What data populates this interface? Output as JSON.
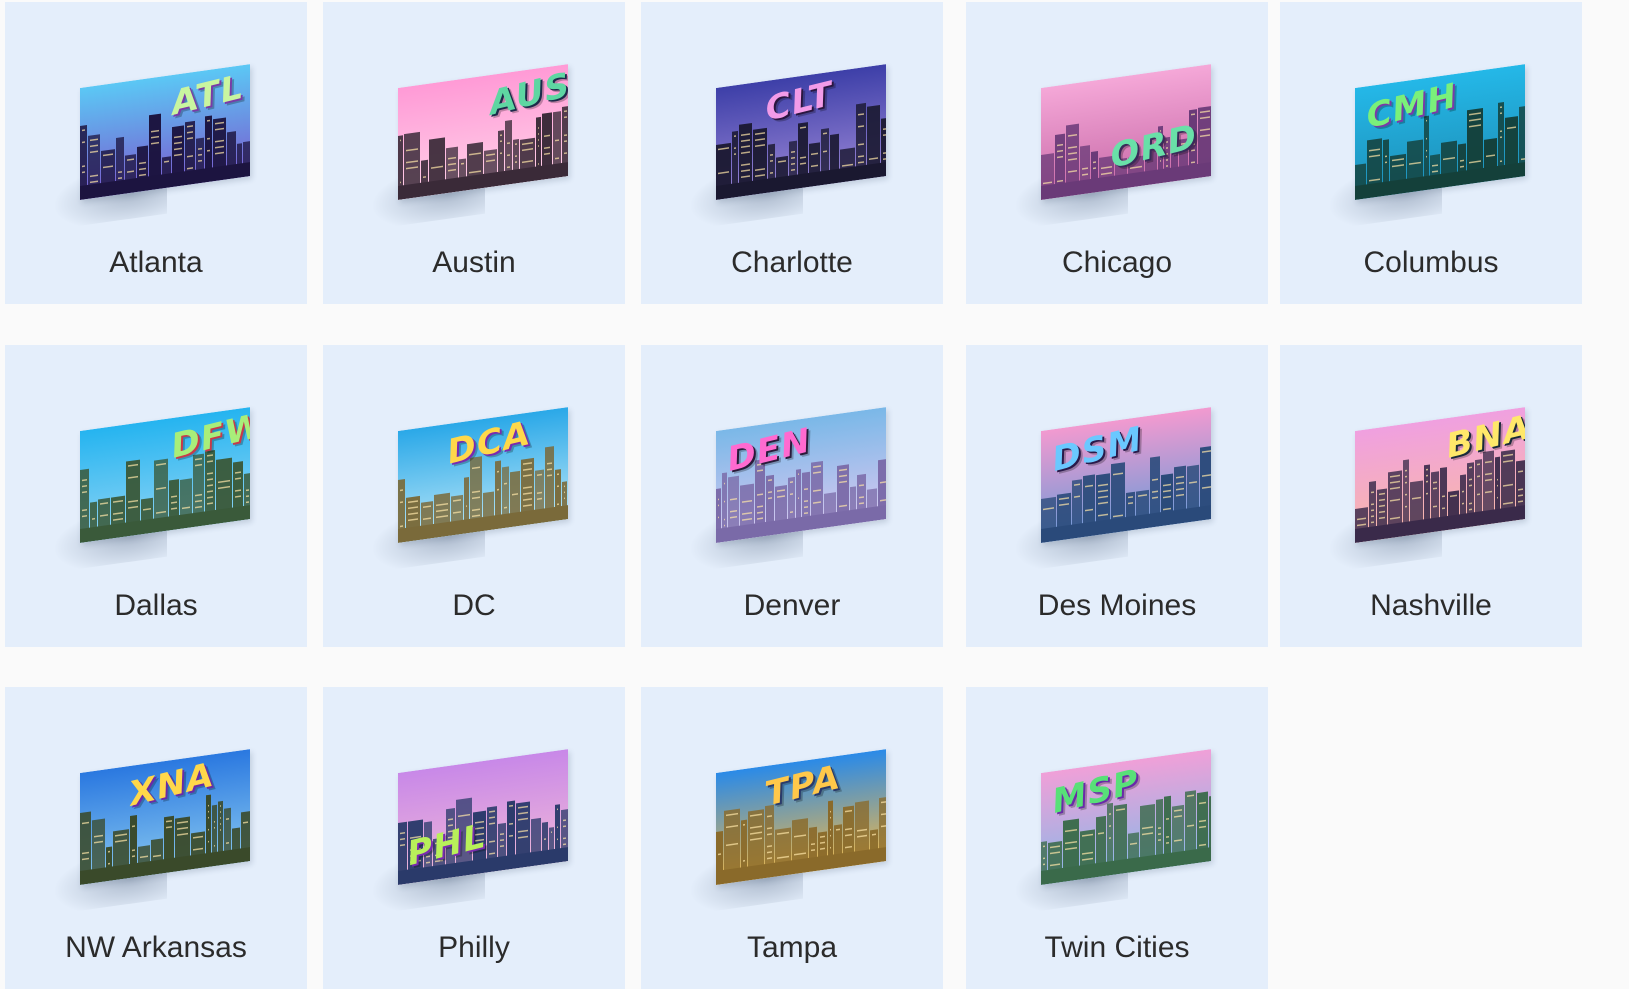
{
  "cities": [
    {
      "name": "Atlanta",
      "code": "ATL",
      "code_color": "#c9f5a0",
      "code_shadow": "#7a3aa8",
      "sky_top": "#5bc8f5",
      "sky_bottom": "#7a5ad0",
      "ground": "#1c1440",
      "code_pos": "top-right"
    },
    {
      "name": "Austin",
      "code": "AUS",
      "code_color": "#5ed6a2",
      "code_shadow": "#1c2a4a",
      "sky_top": "#ff9ad6",
      "sky_bottom": "#ffd0e8",
      "ground": "#3a2a38",
      "code_pos": "top-right"
    },
    {
      "name": "Charlotte",
      "code": "CLT",
      "code_color": "#f29be8",
      "code_shadow": "#2a1640",
      "sky_top": "#3d3fa8",
      "sky_bottom": "#9a86d6",
      "ground": "#1a1830",
      "code_pos": "top-center"
    },
    {
      "name": "Chicago",
      "code": "ORD",
      "code_color": "#69e0a8",
      "code_shadow": "#3a2a5a",
      "sky_top": "#f5a8d8",
      "sky_bottom": "#c86aa8",
      "ground": "#6a3a78",
      "code_pos": "bottom-center"
    },
    {
      "name": "Columbus",
      "code": "CMH",
      "code_color": "#7af07a",
      "code_shadow": "#7a3aa8",
      "sky_top": "#24b8e8",
      "sky_bottom": "#1e8fb8",
      "ground": "#14403a",
      "code_pos": "top-left"
    },
    {
      "name": "Dallas",
      "code": "DFW",
      "code_color": "#a8ee7a",
      "code_shadow": "#c83a4a",
      "sky_top": "#25b4f0",
      "sky_bottom": "#8ed4f5",
      "ground": "#3a5a3a",
      "code_pos": "top-right"
    },
    {
      "name": "DC",
      "code": "DCA",
      "code_color": "#ffd84a",
      "code_shadow": "#7a2ab0",
      "sky_top": "#2aa8e8",
      "sky_bottom": "#b8e6f8",
      "ground": "#7a6a3a",
      "code_pos": "top-center"
    },
    {
      "name": "Denver",
      "code": "DEN",
      "code_color": "#ff6ad0",
      "code_shadow": "#2a1a3a",
      "sky_top": "#7ab8e8",
      "sky_bottom": "#d8c8f0",
      "ground": "#7a6aa8",
      "code_pos": "top-left"
    },
    {
      "name": "Des Moines",
      "code": "DSM",
      "code_color": "#6ac8ff",
      "code_shadow": "#2a1a4a",
      "sky_top": "#f29ad0",
      "sky_bottom": "#6a9ad8",
      "ground": "#2a4a7a",
      "code_pos": "top-left"
    },
    {
      "name": "Nashville",
      "code": "BNA",
      "code_color": "#ffe86a",
      "code_shadow": "#1a2a3a",
      "sky_top": "#f0a0e0",
      "sky_bottom": "#f8b8a8",
      "ground": "#3a2a4a",
      "code_pos": "top-right"
    },
    {
      "name": "NW Arkansas",
      "code": "XNA",
      "code_color": "#ffd84a",
      "code_shadow": "#6a2aa8",
      "sky_top": "#2a78e0",
      "sky_bottom": "#88c8f0",
      "ground": "#3a4a2a",
      "code_pos": "top-center"
    },
    {
      "name": "Philly",
      "code": "PHL",
      "code_color": "#b8f05a",
      "code_shadow": "#7a2ab0",
      "sky_top": "#c888e8",
      "sky_bottom": "#f0b8d8",
      "ground": "#2a3a6a",
      "code_pos": "bottom-left"
    },
    {
      "name": "Tampa",
      "code": "TPA",
      "code_color": "#ffc84a",
      "code_shadow": "#2a3a6a",
      "sky_top": "#2a8ae8",
      "sky_bottom": "#f0b848",
      "ground": "#8a6a2a",
      "code_pos": "top-center"
    },
    {
      "name": "Twin Cities",
      "code": "MSP",
      "code_color": "#58e078",
      "code_shadow": "#6a2aa8",
      "sky_top": "#f0a0d8",
      "sky_bottom": "#88b8e8",
      "ground": "#3a6a4a",
      "code_pos": "top-left"
    }
  ]
}
